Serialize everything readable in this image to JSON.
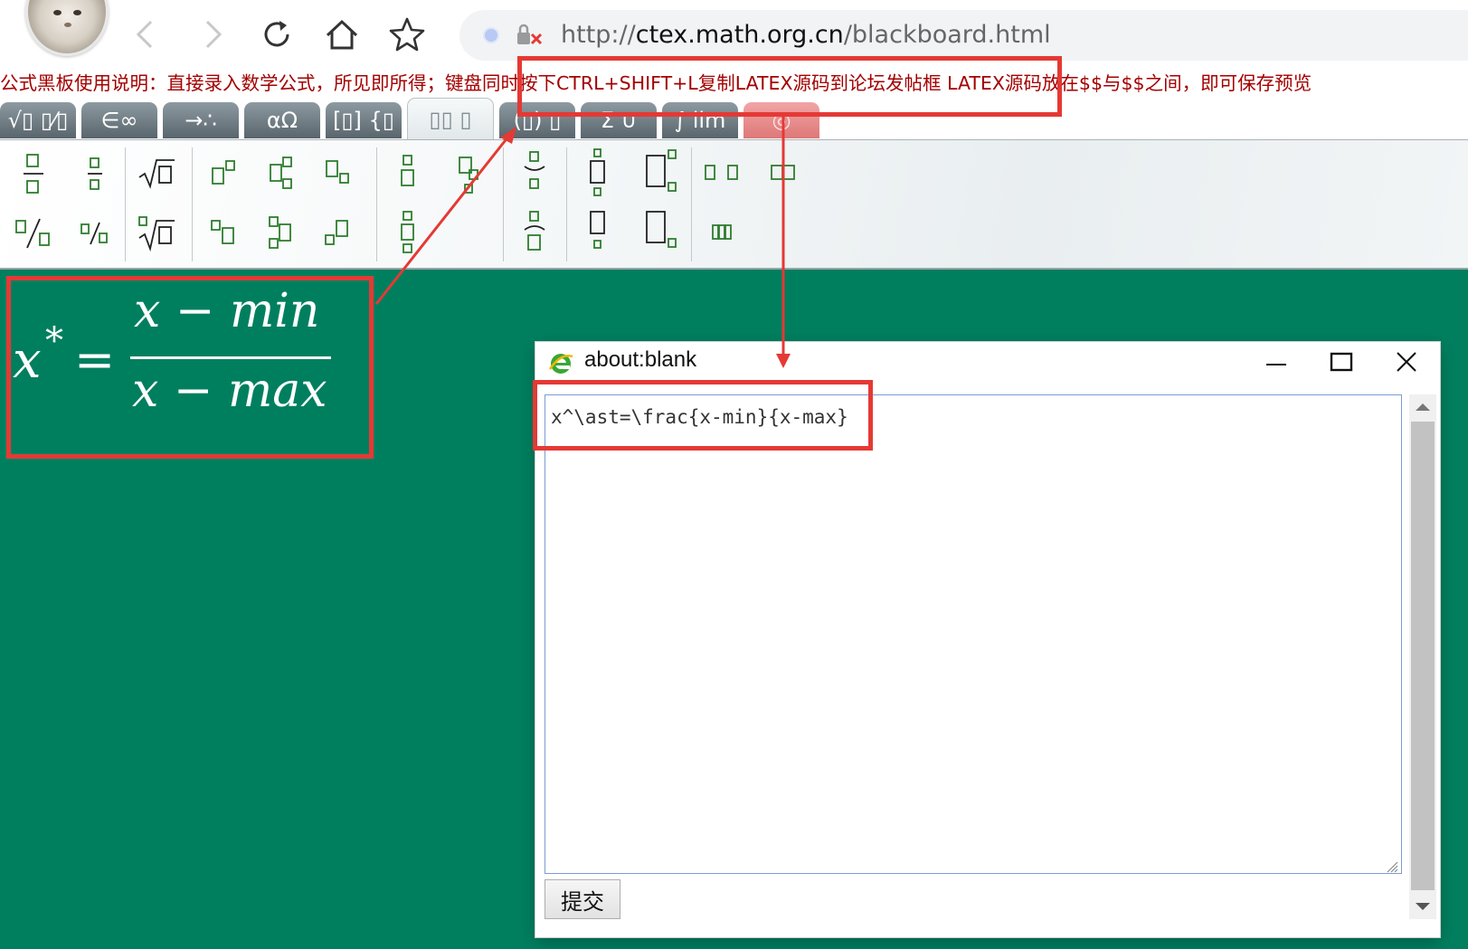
{
  "browser": {
    "url_protocol": "http://",
    "url_host": "ctex.math.org.cn",
    "url_path": "/blackboard.html"
  },
  "instructions": "公式黑板使用说明：直接录入数学公式，所见即所得；键盘同时按下CTRL+SHIFT+L复制LATEX源码到论坛发帖框  LATEX源码放在$$与$$之间，即可保存预览",
  "tabs": [
    {
      "label": "√▯ ▯⁄▯",
      "icon": "radical-fraction-icon"
    },
    {
      "label": "∈∞",
      "icon": "element-infinity-icon"
    },
    {
      "label": "→∴",
      "icon": "arrows-dots-icon"
    },
    {
      "label": "αΩ",
      "icon": "greek-letters-icon"
    },
    {
      "label": "[▯] {▯",
      "icon": "matrix-brace-icon"
    },
    {
      "label": "▯▯ ▯",
      "icon": "scripts-icon",
      "active": true
    },
    {
      "label": "(▯) ▯",
      "icon": "brackets-icon"
    },
    {
      "label": "Σ ∪",
      "icon": "sum-union-icon"
    },
    {
      "label": "∫ lim",
      "icon": "integral-limit-icon"
    },
    {
      "label": "◎",
      "icon": "special-icon"
    }
  ],
  "formula": {
    "lhs": "x",
    "sup": "*",
    "equals": "=",
    "numerator": "x − min",
    "denominator": "x − max"
  },
  "popup": {
    "title": "about:blank",
    "latex_source": "x^\\ast=\\frac{x-min}{x-max}",
    "submit_label": "提交"
  },
  "colors": {
    "board": "#007f5f",
    "highlight": "#e53935",
    "instructions_text": "#a40000"
  }
}
